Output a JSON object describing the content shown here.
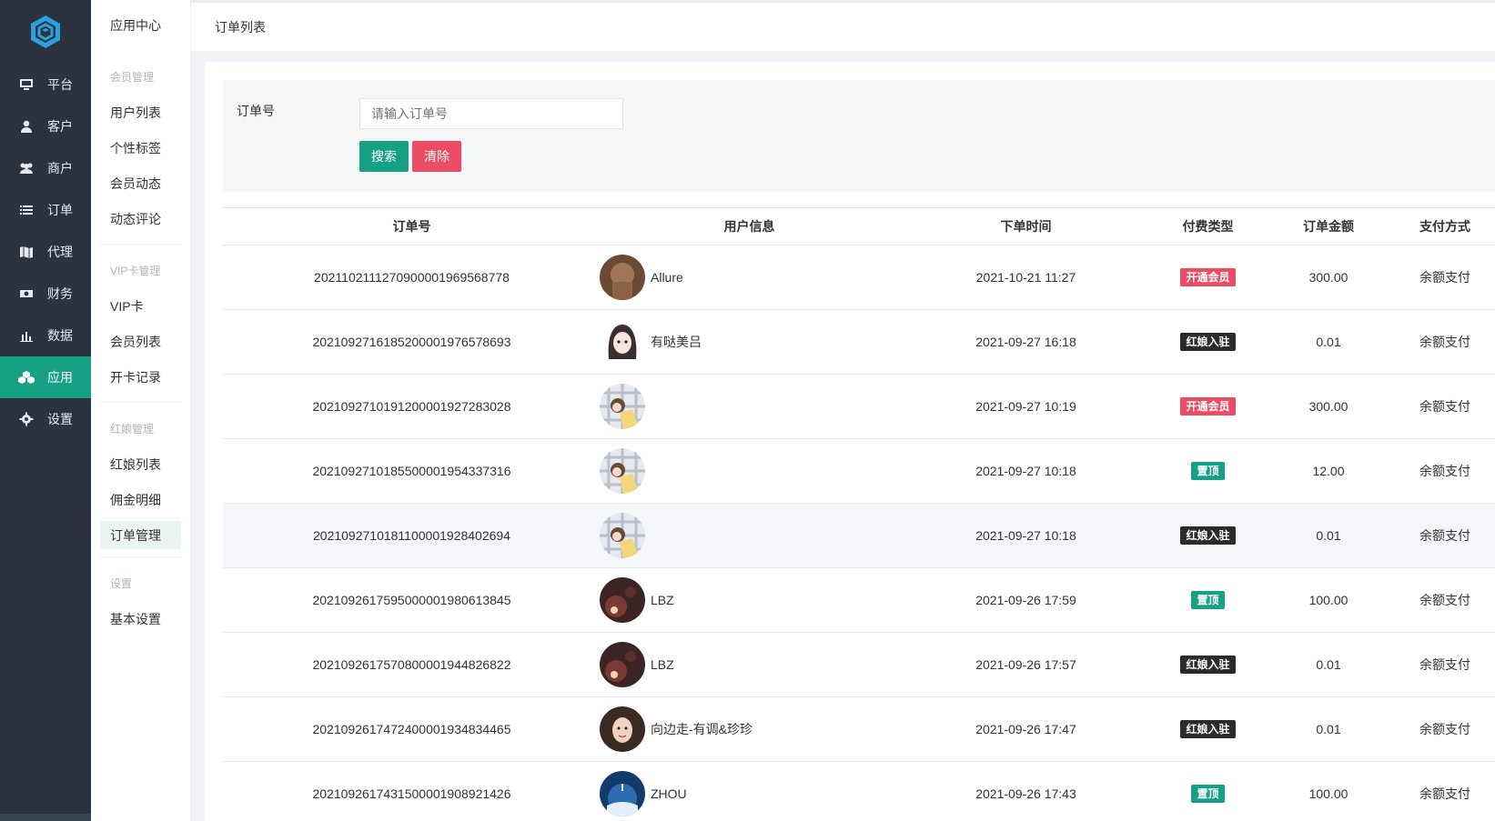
{
  "nav": {
    "items": [
      {
        "label": "平台",
        "icon": "monitor-icon"
      },
      {
        "label": "客户",
        "icon": "user-icon"
      },
      {
        "label": "商户",
        "icon": "users-icon"
      },
      {
        "label": "订单",
        "icon": "list-icon"
      },
      {
        "label": "代理",
        "icon": "map-icon"
      },
      {
        "label": "财务",
        "icon": "money-icon"
      },
      {
        "label": "数据",
        "icon": "bar-chart-icon"
      },
      {
        "label": "应用",
        "icon": "cubes-icon"
      },
      {
        "label": "设置",
        "icon": "gear-icon"
      }
    ],
    "active_index": 7,
    "accent": "#16a085"
  },
  "sub": {
    "title": "应用中心",
    "groups": [
      {
        "label": "会员管理",
        "items": [
          "用户列表",
          "个性标签",
          "会员动态",
          "动态评论"
        ]
      },
      {
        "label": "VIP卡管理",
        "items": [
          "VIP卡",
          "会员列表",
          "开卡记录"
        ]
      },
      {
        "label": "红娘管理",
        "items": [
          "红娘列表",
          "佣金明细",
          "订单管理"
        ]
      },
      {
        "label": "设置",
        "items": [
          "基本设置"
        ]
      }
    ],
    "active_item": "订单管理"
  },
  "topbar": {
    "crumb": "订单列表"
  },
  "filter": {
    "label": "订单号",
    "placeholder": "请输入订单号",
    "search_label": "搜索",
    "clear_label": "清除"
  },
  "table": {
    "headers": [
      "订单号",
      "用户信息",
      "下单时间",
      "付费类型",
      "订单金额",
      "支付方式"
    ],
    "rows": [
      {
        "order": "20211021112709000019695687​78",
        "user": "Allure",
        "avatar": "brown",
        "time": "2021-10-21 11:27",
        "type": "开通会员",
        "type_style": "red",
        "amount": "300.00",
        "pay": "余额支付"
      },
      {
        "order": "20210927161852000019765786​93",
        "user": "有哒美吕",
        "avatar": "anime",
        "time": "2021-09-27 16:18",
        "type": "红娘入驻",
        "type_style": "black",
        "amount": "0.01",
        "pay": "余额支付"
      },
      {
        "order": "20210927101912000019272830​28",
        "user": "",
        "avatar": "plaid",
        "time": "2021-09-27 10:19",
        "type": "开通会员",
        "type_style": "red",
        "amount": "300.00",
        "pay": "余额支付"
      },
      {
        "order": "20210927101855000019543373​16",
        "user": "",
        "avatar": "plaid",
        "time": "2021-09-27 10:18",
        "type": "置顶",
        "type_style": "green",
        "amount": "12.00",
        "pay": "余额支付"
      },
      {
        "order": "20210927101811000019284026​94",
        "user": "",
        "avatar": "plaid",
        "time": "2021-09-27 10:18",
        "type": "红娘入驻",
        "type_style": "black",
        "amount": "0.01",
        "pay": "余额支付"
      },
      {
        "order": "20210926175950000019806138​45",
        "user": "LBZ",
        "avatar": "dark",
        "time": "2021-09-26 17:59",
        "type": "置顶",
        "type_style": "green",
        "amount": "100.00",
        "pay": "余额支付"
      },
      {
        "order": "20210926175708000019448268​22",
        "user": "LBZ",
        "avatar": "dark",
        "time": "2021-09-26 17:57",
        "type": "红娘入驻",
        "type_style": "black",
        "amount": "0.01",
        "pay": "余额支付"
      },
      {
        "order": "20210926174724000019348344​65",
        "user": "向边走-有调&珍珍",
        "avatar": "face",
        "time": "2021-09-26 17:47",
        "type": "红娘入驻",
        "type_style": "black",
        "amount": "0.01",
        "pay": "余额支付"
      },
      {
        "order": "20210926174315000019089214​26",
        "user": "ZHOU",
        "avatar": "blue",
        "time": "2021-09-26 17:43",
        "type": "置顶",
        "type_style": "green",
        "amount": "100.00",
        "pay": "余额支付"
      }
    ]
  }
}
